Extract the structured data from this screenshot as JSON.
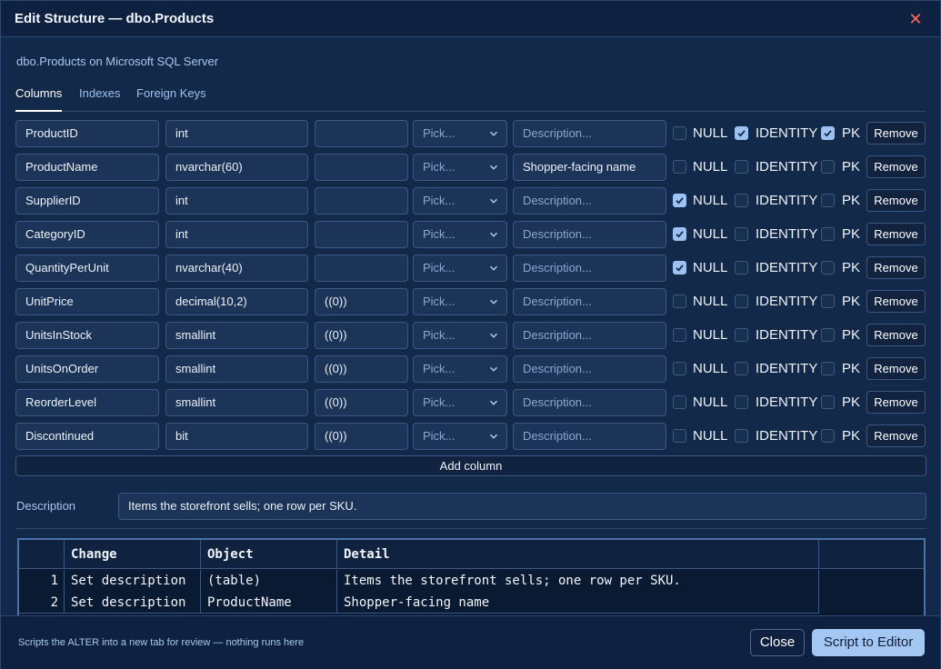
{
  "window": {
    "title": "Edit Structure — dbo.Products",
    "close_icon": "close-icon"
  },
  "subtitle": "dbo.Products on Microsoft SQL Server",
  "tabs": [
    {
      "label": "Columns",
      "active": true
    },
    {
      "label": "Indexes",
      "active": false
    },
    {
      "label": "Foreign Keys",
      "active": false
    }
  ],
  "labels": {
    "null": "NULL",
    "identity": "IDENTITY",
    "pk": "PK",
    "remove": "Remove"
  },
  "placeholders": {
    "pick": "Pick...",
    "description": "Description..."
  },
  "columns": [
    {
      "name": "ProductID",
      "type": "int",
      "default": "",
      "description": "",
      "null": false,
      "identity": true,
      "pk": true
    },
    {
      "name": "ProductName",
      "type": "nvarchar(60)",
      "default": "",
      "description": "Shopper-facing name",
      "null": false,
      "identity": false,
      "pk": false
    },
    {
      "name": "SupplierID",
      "type": "int",
      "default": "",
      "description": "",
      "null": true,
      "identity": false,
      "pk": false
    },
    {
      "name": "CategoryID",
      "type": "int",
      "default": "",
      "description": "",
      "null": true,
      "identity": false,
      "pk": false
    },
    {
      "name": "QuantityPerUnit",
      "type": "nvarchar(40)",
      "default": "",
      "description": "",
      "null": true,
      "identity": false,
      "pk": false
    },
    {
      "name": "UnitPrice",
      "type": "decimal(10,2)",
      "default": "((0))",
      "description": "",
      "null": false,
      "identity": false,
      "pk": false
    },
    {
      "name": "UnitsInStock",
      "type": "smallint",
      "default": "((0))",
      "description": "",
      "null": false,
      "identity": false,
      "pk": false
    },
    {
      "name": "UnitsOnOrder",
      "type": "smallint",
      "default": "((0))",
      "description": "",
      "null": false,
      "identity": false,
      "pk": false
    },
    {
      "name": "ReorderLevel",
      "type": "smallint",
      "default": "((0))",
      "description": "",
      "null": false,
      "identity": false,
      "pk": false
    },
    {
      "name": "Discontinued",
      "type": "bit",
      "default": "((0))",
      "description": "",
      "null": false,
      "identity": false,
      "pk": false
    }
  ],
  "add_column_label": "Add column",
  "table_description": {
    "label": "Description",
    "value": "Items the storefront sells; one row per SKU."
  },
  "changes": {
    "headers": [
      "Change",
      "Object",
      "Detail"
    ],
    "rows": [
      {
        "num": "1",
        "change": "Set description",
        "object": "(table)",
        "detail": "Items the storefront sells; one row per SKU."
      },
      {
        "num": "2",
        "change": "Set description",
        "object": "ProductName",
        "detail": "Shopper-facing name"
      }
    ]
  },
  "footer": {
    "hint": "Scripts the ALTER into a new tab for review — nothing runs here",
    "close_label": "Close",
    "script_label": "Script to Editor"
  },
  "colors": {
    "accent": "#a3c6f3",
    "close_x": "#ff6b5e",
    "background": "#13294a"
  }
}
